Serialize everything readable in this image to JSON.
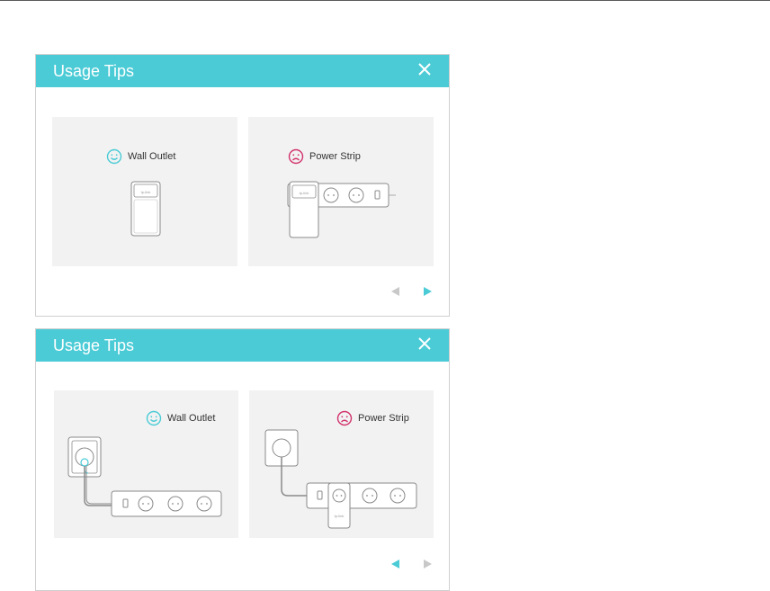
{
  "dialogs": [
    {
      "title": "Usage Tips",
      "panels": [
        {
          "label": "Wall Outlet",
          "mood": "happy-face-icon",
          "mood_color": "#4acbd6"
        },
        {
          "label": "Power Strip",
          "mood": "sad-face-icon",
          "mood_color": "#d2316b"
        }
      ],
      "prev_active": false,
      "next_active": true
    },
    {
      "title": "Usage Tips",
      "panels": [
        {
          "label": "Wall Outlet",
          "mood": "happy-face-icon",
          "mood_color": "#4acbd6"
        },
        {
          "label": "Power Strip",
          "mood": "sad-face-icon",
          "mood_color": "#d2316b"
        }
      ],
      "prev_active": true,
      "next_active": false
    }
  ],
  "icons": {
    "close": "close-icon",
    "prev": "triangle-left-icon",
    "next": "triangle-right-icon"
  },
  "colors": {
    "header": "#4acbd6",
    "active_arrow": "#4acbd6",
    "inactive_arrow": "#c8c8c8",
    "panel_bg": "#f2f2f2"
  }
}
